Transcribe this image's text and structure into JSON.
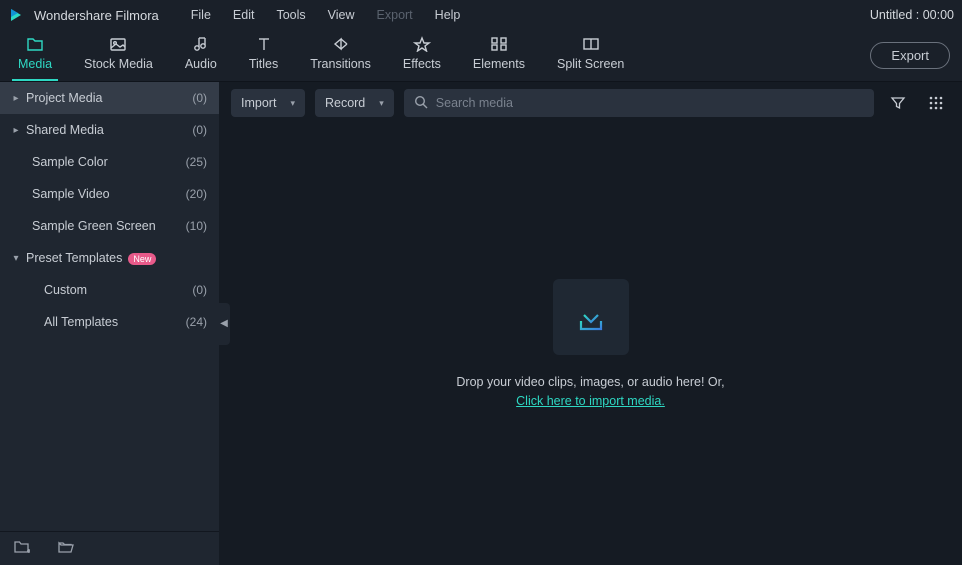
{
  "app": {
    "title": "Wondershare Filmora",
    "doc_title": "Untitled : 00:00"
  },
  "menubar": {
    "items": [
      {
        "label": "File",
        "disabled": false
      },
      {
        "label": "Edit",
        "disabled": false
      },
      {
        "label": "Tools",
        "disabled": false
      },
      {
        "label": "View",
        "disabled": false
      },
      {
        "label": "Export",
        "disabled": true
      },
      {
        "label": "Help",
        "disabled": false
      }
    ]
  },
  "toolbar": {
    "tabs": [
      {
        "label": "Media"
      },
      {
        "label": "Stock Media"
      },
      {
        "label": "Audio"
      },
      {
        "label": "Titles"
      },
      {
        "label": "Transitions"
      },
      {
        "label": "Effects"
      },
      {
        "label": "Elements"
      },
      {
        "label": "Split Screen"
      }
    ],
    "export_label": "Export"
  },
  "sidebar": {
    "items": [
      {
        "label": "Project Media",
        "count": "(0)",
        "arrow": "right",
        "active": true,
        "indent": 0,
        "badge": null
      },
      {
        "label": "Shared Media",
        "count": "(0)",
        "arrow": "right",
        "active": false,
        "indent": 0,
        "badge": null
      },
      {
        "label": "Sample Color",
        "count": "(25)",
        "arrow": "none",
        "active": false,
        "indent": 0,
        "badge": null
      },
      {
        "label": "Sample Video",
        "count": "(20)",
        "arrow": "none",
        "active": false,
        "indent": 0,
        "badge": null
      },
      {
        "label": "Sample Green Screen",
        "count": "(10)",
        "arrow": "none",
        "active": false,
        "indent": 0,
        "badge": null
      },
      {
        "label": "Preset Templates",
        "count": "",
        "arrow": "down",
        "active": false,
        "indent": 0,
        "badge": "New"
      },
      {
        "label": "Custom",
        "count": "(0)",
        "arrow": "none",
        "active": false,
        "indent": 1,
        "badge": null
      },
      {
        "label": "All Templates",
        "count": "(24)",
        "arrow": "none",
        "active": false,
        "indent": 1,
        "badge": null
      }
    ]
  },
  "content_toolbar": {
    "import_label": "Import",
    "record_label": "Record",
    "search_placeholder": "Search media"
  },
  "drop_area": {
    "line1": "Drop your video clips, images, or audio here! Or,",
    "link": "Click here to import media."
  }
}
